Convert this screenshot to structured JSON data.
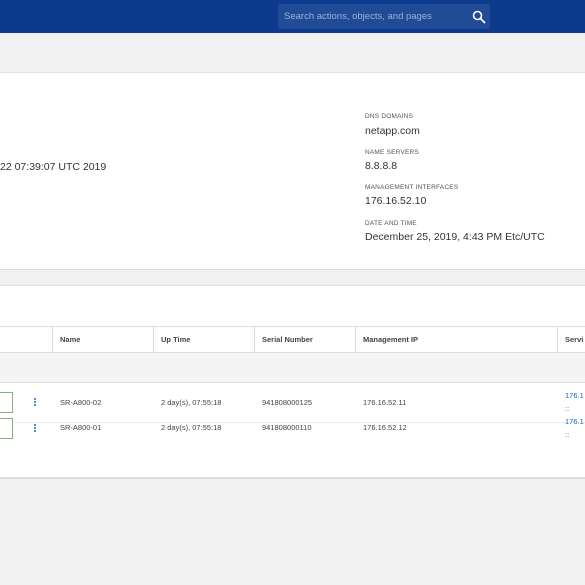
{
  "header": {
    "search_placeholder": "Search actions, objects, and pages",
    "search_icon": "search-icon",
    "bar_color": "#0d3a8c"
  },
  "overview": {
    "boot_time": "22 07:39:07 UTC 2019",
    "dns_domains_label": "DNS DOMAINS",
    "dns_domains_value": "netapp.com",
    "name_servers_label": "NAME SERVERS",
    "name_servers_value": "8.8.8.8",
    "mgmt_interfaces_label": "MANAGEMENT INTERFACES",
    "mgmt_interfaces_value": "176.16.52.10",
    "date_time_label": "DATE AND TIME",
    "date_time_value": "December 25, 2019, 4:43 PM  Etc/UTC"
  },
  "table": {
    "headers": [
      "Name",
      "Up Time",
      "Serial Number",
      "Management IP",
      "Servi"
    ],
    "rows": [
      {
        "name": "SR-A800-02",
        "uptime": "2 day(s), 07:55:18",
        "serial": "941808000125",
        "mgmt_ip": "176.16.52.11",
        "service1": "176.1",
        "service2": "::"
      },
      {
        "name": "SR-A800-01",
        "uptime": "2 day(s), 07:55:18",
        "serial": "941808000110",
        "mgmt_ip": "176.16.52.12",
        "service1": "176.1",
        "service2": "::"
      }
    ]
  }
}
